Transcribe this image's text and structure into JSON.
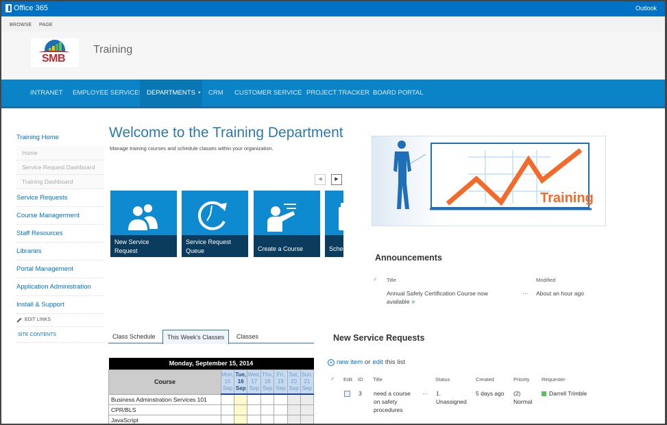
{
  "suitebar": {
    "brand": "Office 365",
    "right_link": "Outlook"
  },
  "ribbon": {
    "tabs": [
      "BROWSE",
      "PAGE"
    ]
  },
  "header": {
    "logo_text": "SMB",
    "site_title": "Training"
  },
  "topnav": {
    "items": [
      "INTRANET",
      "EMPLOYEE SERVICES",
      "DEPARTMENTS",
      "CRM",
      "CUSTOMER SERVICE",
      "PROJECT TRACKER",
      "BOARD PORTAL"
    ],
    "active": "DEPARTMENTS"
  },
  "leftnav": {
    "training_home": "Training Home",
    "sub_items": [
      "Home",
      "Service Request Dashboard",
      "Training Dashboard"
    ],
    "items": [
      "Service Requests",
      "Course Managerment",
      "Staff Resources",
      "Libraries",
      "Portal Management",
      "Application Administration",
      "Install & Support"
    ],
    "edit_links": "EDIT LINKS",
    "site_contents": "SITE CONTENTS"
  },
  "welcome": {
    "title": "Welcome to the Training Department",
    "subtitle": "Manage training courses and schedule classes within your organization."
  },
  "tiles": [
    {
      "label": "New Service Request",
      "icon": "people-icon"
    },
    {
      "label": "Service Request Queue",
      "icon": "clock-refresh-icon"
    },
    {
      "label": "Create a Course",
      "icon": "presenter-icon"
    },
    {
      "label": "Schedule",
      "icon": "calendar-icon"
    }
  ],
  "banner": {
    "text": "Training"
  },
  "announcements": {
    "title": "Announcements",
    "columns": [
      "Title",
      "Modified"
    ],
    "rows": [
      {
        "title": "Annual Safety Certification Course now available",
        "modified": "About an hour ago"
      }
    ]
  },
  "tabs": {
    "items": [
      "Class Schedule",
      "This Week's Classes",
      "Classes"
    ],
    "active": "This Week's Classes"
  },
  "calendar": {
    "title": "Monday, September 15, 2014",
    "course_header": "Course",
    "days": [
      {
        "dow": "Mon,",
        "date": "15",
        "mon": "Sep"
      },
      {
        "dow": "Tue,",
        "date": "16",
        "mon": "Sep"
      },
      {
        "dow": "Wed,",
        "date": "17",
        "mon": "Sep"
      },
      {
        "dow": "Thu,",
        "date": "18",
        "mon": "Sep"
      },
      {
        "dow": "Fri,",
        "date": "19",
        "mon": "Sep"
      },
      {
        "dow": "Sat,",
        "date": "20",
        "mon": "Sep"
      },
      {
        "dow": "Sun,",
        "date": "21",
        "mon": "Sep"
      }
    ],
    "today_index": 1,
    "courses": [
      "Business Adminstration Services 101",
      "CPR/BLS",
      "JavaScript"
    ]
  },
  "service_requests": {
    "title": "New Service Requests",
    "new_item": "new item",
    "or": "or",
    "edit": "edit",
    "this_list": "this list",
    "columns": [
      "Edit",
      "ID",
      "Title",
      "Status",
      "Created",
      "Priority",
      "Requester"
    ],
    "rows": [
      {
        "id": "3",
        "title": "need a course on safety procedures",
        "status": "1. Unassigned",
        "created": "5 days ago",
        "priority": "(2) Normal",
        "requester": "Darrell Trimble"
      }
    ]
  },
  "colors": {
    "suite_blue": "#0072c6",
    "nav_blue": "#0a84c6",
    "tile_blue": "#0e8ad0",
    "tile_label": "#0b3c5d",
    "accent_orange": "#f26b2a"
  }
}
